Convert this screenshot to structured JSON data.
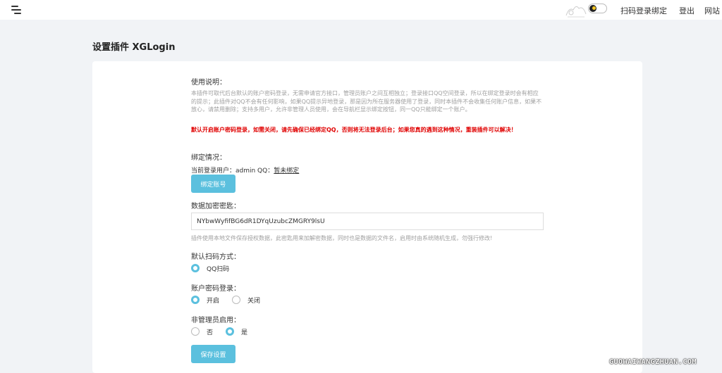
{
  "header": {
    "menu_icon": "hamburger-menu-icon",
    "theme_toggle_icon": "moon-icon",
    "scan_bind_label": "扫码登录绑定",
    "logout_label": "登出",
    "site_label": "网站"
  },
  "page": {
    "title": "设置插件 XGLogin"
  },
  "usage": {
    "label": "使用说明：",
    "description": "本插件可取代后台默认的账户密码登录，无需申请官方接口，管理员账户之间互相独立；登录接口QQ空间登录，所以在绑定登录时会有相应的提示；此插件对QQ不会有任何影响，如果QQ提示异地登录，那是因为所在服务器使用了登录，同时本插件不会收集任何账户信息，如果不放心，请禁用删除；支持多用户，允许非管理人员使用，会在导航栏显示绑定按钮，同一QQ只能绑定一个账户。",
    "warning": "默认开启账户密码登录，如需关闭，请先确保已经绑定QQ，否则将无法登录后台；如果您真的遇到这种情况，重装插件可以解决！"
  },
  "binding": {
    "label": "绑定情况：",
    "user_prefix": "当前登录用户：admin  QQ：",
    "unbound_text": "暂未绑定",
    "bind_button": "绑定账号"
  },
  "encryption": {
    "label": "数据加密密匙：",
    "value": "NYbwWyfifBG6dR1DYqUzubcZMGRY9lsU",
    "hint": "插件使用本地文件保存授权数据，此密匙用来加解密数据，同时也是数据的文件名，启用时由系统随机生成，勿强行修改!"
  },
  "scan_method": {
    "label": "默认扫码方式：",
    "options": [
      {
        "label": "QQ扫码",
        "selected": true
      }
    ]
  },
  "password_login": {
    "label": "账户密码登录：",
    "options": [
      {
        "label": "开启",
        "selected": true
      },
      {
        "label": "关闭",
        "selected": false
      }
    ]
  },
  "non_admin": {
    "label": "非管理员启用：",
    "options": [
      {
        "label": "否",
        "selected": false
      },
      {
        "label": "是",
        "selected": true
      }
    ]
  },
  "save_button": "保存设置",
  "watermark": "GUOWAIWANGZHUAN.COM",
  "colors": {
    "accent": "#5bc0de",
    "warning": "#e00000",
    "page_bg": "#f1f3f6"
  }
}
